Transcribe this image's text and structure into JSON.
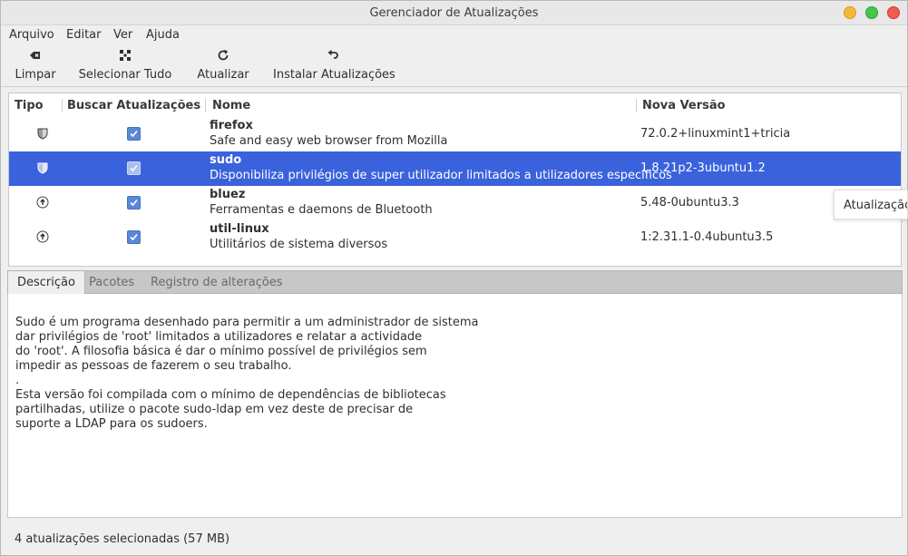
{
  "window": {
    "title": "Gerenciador de Atualizações"
  },
  "menu": [
    "Arquivo",
    "Editar",
    "Ver",
    "Ajuda"
  ],
  "toolbar": {
    "clear_label": "Limpar",
    "select_all_label": "Selecionar Tudo",
    "refresh_label": "Atualizar",
    "install_label": "Instalar Atualizações"
  },
  "columns": {
    "type": "Tipo",
    "check": "Buscar Atualizações",
    "name": "Nome",
    "version": "Nova Versão"
  },
  "updates": [
    {
      "name": "firefox",
      "description": "Safe and easy web browser from Mozilla",
      "version": "72.0.2+linuxmint1+tricia",
      "type_icon": "shield-icon",
      "checked": true
    },
    {
      "name": "sudo",
      "description": "Disponibiliza privilégios de super utilizador limitados a utilizadores específicos",
      "version": "1.8.21p2-3ubuntu1.2",
      "type_icon": "shield-icon",
      "checked": true
    },
    {
      "name": "bluez",
      "description": "Ferramentas e daemons de Bluetooth",
      "version": "5.48-0ubuntu3.3",
      "type_icon": "upgrade-arrow-icon",
      "checked": true
    },
    {
      "name": "util-linux",
      "description": "Utilitários de sistema diversos",
      "version": "1:2.31.1-0.4ubuntu3.5",
      "type_icon": "upgrade-arrow-icon",
      "checked": true
    }
  ],
  "selected_index": 1,
  "tooltip": "Atualização",
  "tabs": [
    "Descrição",
    "Pacotes",
    "Registro de alterações"
  ],
  "active_tab": 0,
  "description_lines": [
    "Sudo é um programa desenhado para permitir a um administrador de sistema",
    "dar privilégios de 'root' limitados a utilizadores e relatar a actividade",
    "do 'root'. A filosofia básica é dar o mínimo possível de privilégios sem",
    "impedir as pessoas de fazerem o seu trabalho.",
    ".",
    "Esta versão foi compilada com o mínimo de dependências de bibliotecas",
    "partilhadas, utilize o pacote sudo-ldap em vez deste de precisar de",
    "suporte a LDAP para os sudoers."
  ],
  "status": "4 atualizações selecionadas (57 MB)",
  "colors": {
    "selection": "#3a62dd",
    "checkbox": "#5a87d6"
  }
}
